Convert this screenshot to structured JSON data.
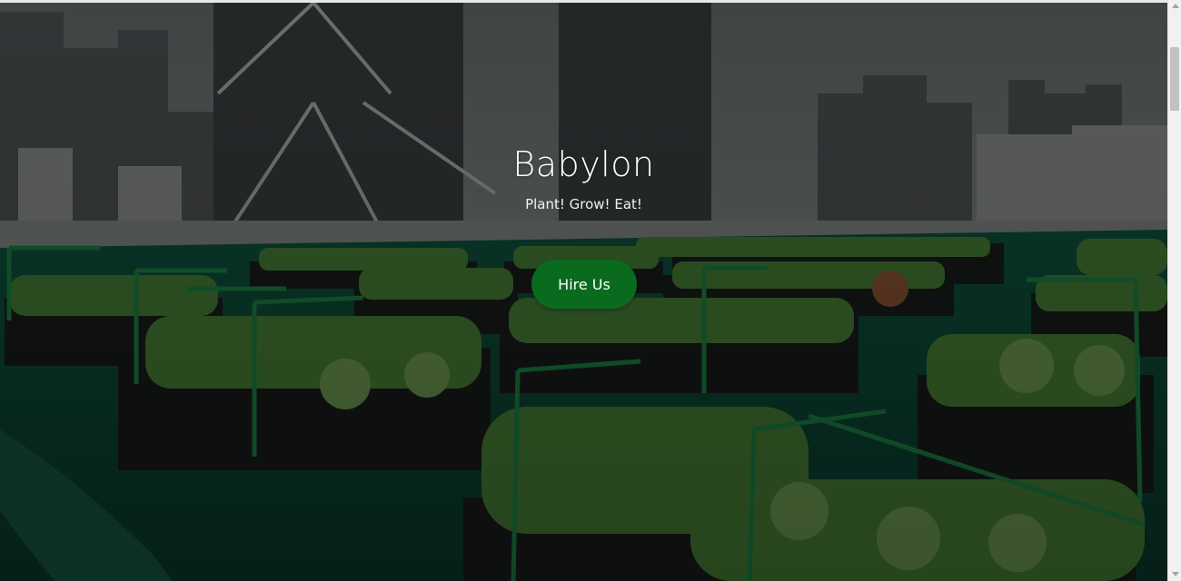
{
  "hero": {
    "title": "Babylon",
    "tagline": "Plant! Grow! Eat!",
    "cta_label": "Hire Us",
    "background_image": "rooftop-garden-city-skyline",
    "overlay_color": "#000000",
    "cta_color": "#0a6b1f"
  },
  "scrollbar": {
    "icon_up": "scroll-up-arrow",
    "icon_down": "scroll-down-arrow"
  }
}
